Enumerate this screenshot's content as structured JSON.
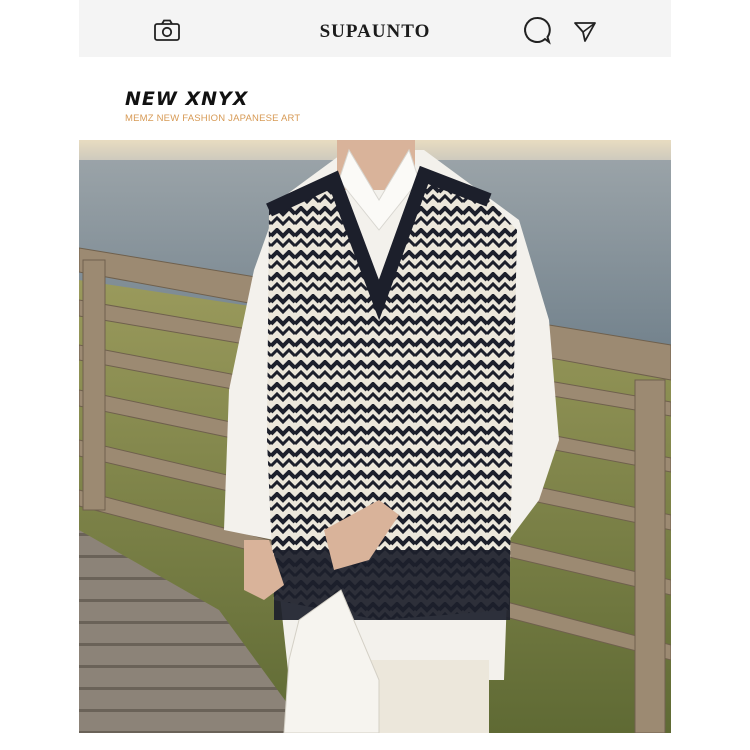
{
  "header": {
    "brand": "SUPAUNTO",
    "icons": [
      "camera-icon",
      "chat-bubble-icon",
      "send-icon"
    ]
  },
  "section": {
    "title": "NEW XNYX",
    "subtitle": "MEMZ NEW FASHION JAPANESE ART"
  },
  "photo": {
    "subject": "model wearing knit sweater vest over white shirt by the sea"
  },
  "colors": {
    "topbar_bg": "#f4f4f4",
    "subtitle": "#d79a55",
    "vest_dark": "#1c1f2b",
    "vest_light": "#ece7db"
  }
}
